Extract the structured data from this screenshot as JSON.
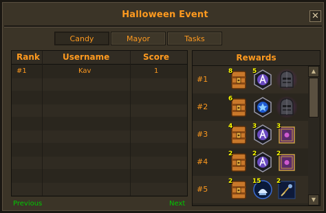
{
  "window": {
    "title": "Halloween Event",
    "close_symbol": "✕"
  },
  "tabs": [
    "Candy",
    "Mayor",
    "Tasks"
  ],
  "active_tab": "Candy",
  "leaderboard": {
    "headers": {
      "rank": "Rank",
      "username": "Username",
      "score": "Score"
    },
    "rows": [
      {
        "rank": "#1",
        "username": "Kav",
        "score": "1"
      }
    ]
  },
  "rewards": {
    "header": "Rewards",
    "rows": [
      {
        "rank": "#1",
        "items": [
          {
            "icon": "treasure-chest-icon",
            "qty": "8"
          },
          {
            "icon": "purple-a-badge-icon",
            "qty": "5"
          },
          {
            "icon": "knight-helmet-icon",
            "qty": ""
          }
        ]
      },
      {
        "rank": "#2",
        "items": [
          {
            "icon": "treasure-chest-icon",
            "qty": "6"
          },
          {
            "icon": "blue-star-badge-icon",
            "qty": ""
          },
          {
            "icon": "knight-helmet-icon",
            "qty": ""
          }
        ]
      },
      {
        "rank": "#3",
        "items": [
          {
            "icon": "treasure-chest-icon",
            "qty": "4"
          },
          {
            "icon": "purple-a-badge-icon",
            "qty": "3"
          },
          {
            "icon": "spellbook-icon",
            "qty": "3"
          }
        ]
      },
      {
        "rank": "#4",
        "items": [
          {
            "icon": "treasure-chest-icon",
            "qty": "2"
          },
          {
            "icon": "purple-a-badge-icon",
            "qty": "2"
          },
          {
            "icon": "spellbook-icon",
            "qty": "2"
          }
        ]
      },
      {
        "rank": "#5",
        "items": [
          {
            "icon": "treasure-chest-icon",
            "qty": "2"
          },
          {
            "icon": "blue-lamp-orb-icon",
            "qty": "15"
          },
          {
            "icon": "dark-lamp-icon",
            "qty": "2"
          }
        ]
      }
    ]
  },
  "footer": {
    "previous": "Previous",
    "next": "Next"
  },
  "colors": {
    "text_orange": "#ff9a1f",
    "link_green": "#00c800",
    "qty_yellow": "#ffff00",
    "highlight_purple": "#5a2a66"
  }
}
